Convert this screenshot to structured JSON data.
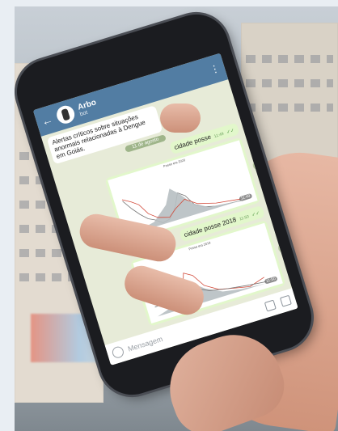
{
  "chat": {
    "contact_name": "Arbo",
    "contact_status": "bot",
    "incoming_message": "Alertas críticos sobre situações anormais relacionadas à Dengue em Goiás.",
    "date_chip": "11 de agosto",
    "messages": [
      {
        "text": "cidade posse",
        "time": "11:49"
      },
      {
        "text": "cidade posse 2018",
        "time": "11:50"
      }
    ],
    "charts": [
      {
        "title": "Posse era 2020",
        "time": "11:49"
      },
      {
        "title": "Posse era 2018",
        "time": "11:50"
      }
    ],
    "input_placeholder": "Mensagem"
  }
}
